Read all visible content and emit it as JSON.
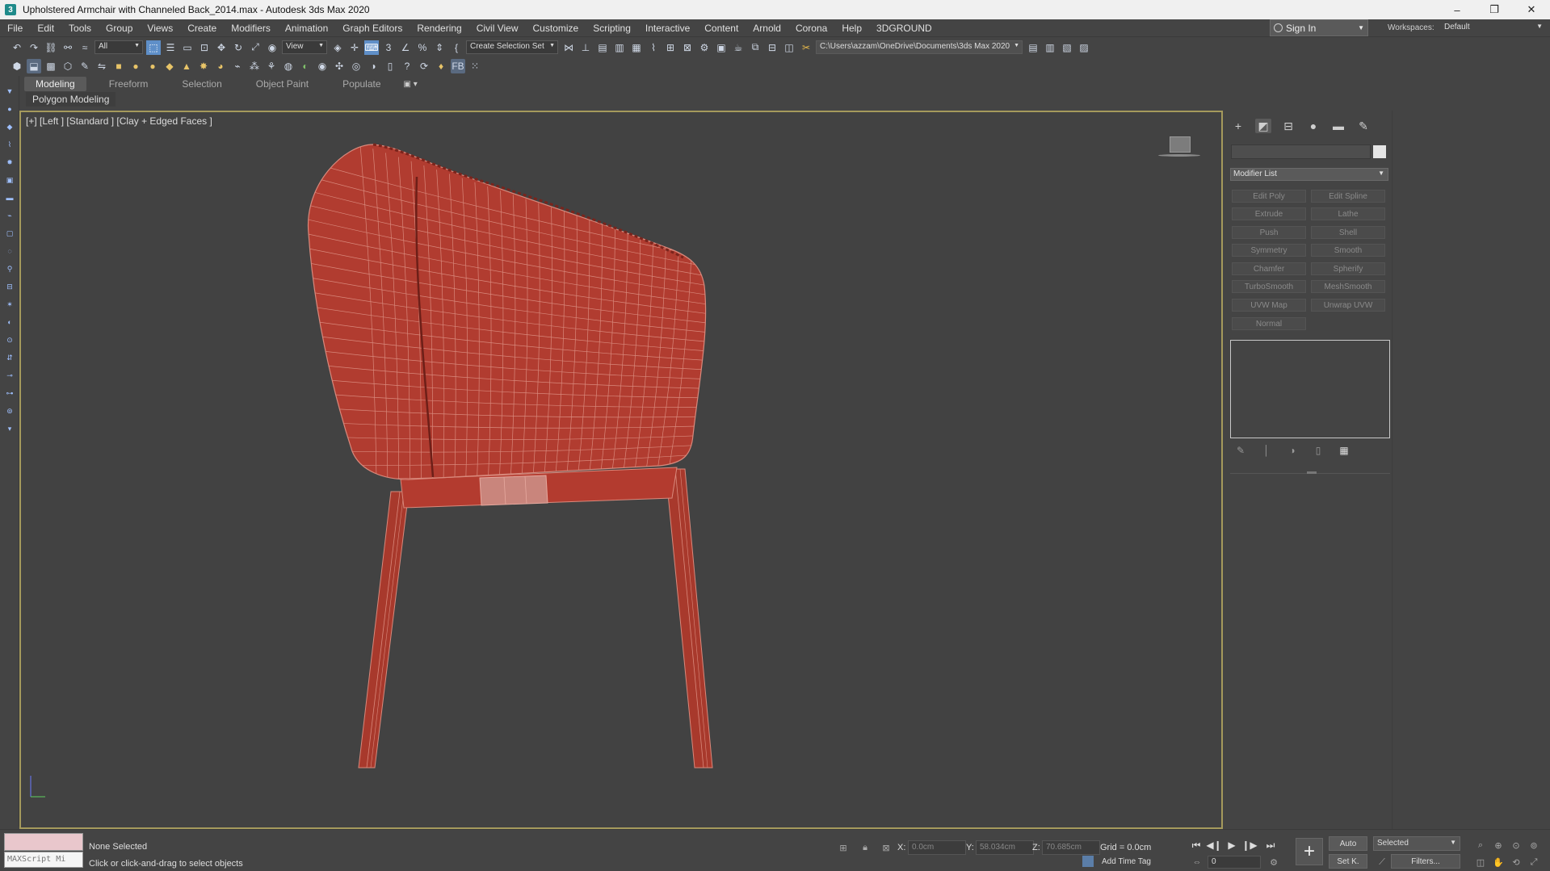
{
  "window": {
    "title": "Upholstered Armchair with Channeled Back_2014.max - Autodesk 3ds Max 2020",
    "app_icon": "3",
    "minimize": "–",
    "restore": "❐",
    "close": "✕"
  },
  "menu": {
    "items": [
      "File",
      "Edit",
      "Tools",
      "Group",
      "Views",
      "Create",
      "Modifiers",
      "Animation",
      "Graph Editors",
      "Rendering",
      "Civil View",
      "Customize",
      "Scripting",
      "Interactive",
      "Content",
      "Arnold",
      "Corona",
      "Help",
      "3DGROUND"
    ],
    "sign_in": "Sign In",
    "workspaces_label": "Workspaces:",
    "workspace_value": "Default"
  },
  "toolbar": {
    "filter_value": "All",
    "refcoord_value": "View",
    "selection_set_placeholder": "Create Selection Set",
    "project_path": "C:\\Users\\azzam\\OneDrive\\Documents\\3ds Max 2020"
  },
  "ribbon": {
    "tabs": [
      "Modeling",
      "Freeform",
      "Selection",
      "Object Paint",
      "Populate"
    ],
    "active_tab": "Modeling",
    "panel_label": "Polygon Modeling"
  },
  "viewport": {
    "label": "[+] [Left ] [Standard ] [Clay + Edged Faces ]",
    "object_color": "#b03a2e",
    "wire_color": "#d9897c",
    "border_color": "#a59a5c"
  },
  "command_panel": {
    "modifier_list": "Modifier List",
    "modifier_buttons": [
      "Edit Poly",
      "Edit Spline",
      "Extrude",
      "Lathe",
      "Push",
      "Shell",
      "Symmetry",
      "Smooth",
      "Chamfer",
      "Spherify",
      "TurboSmooth",
      "MeshSmooth",
      "UVW Map",
      "Unwrap UVW",
      "Normal"
    ]
  },
  "status": {
    "maxscript_placeholder": "MAXScript Mi",
    "selection_text": "None Selected",
    "prompt_text": "Click or click-and-drag to select objects",
    "x_label": "X:",
    "x_value": "0.0cm",
    "y_label": "Y:",
    "y_value": "58.034cm",
    "z_label": "Z:",
    "z_value": "70.685cm",
    "grid_text": "Grid = 0.0cm",
    "add_time_tag": "Add Time Tag",
    "frame_value": "0",
    "auto_label": "Auto",
    "setk_label": "Set K.",
    "selected_value": "Selected",
    "filters_label": "Filters..."
  }
}
